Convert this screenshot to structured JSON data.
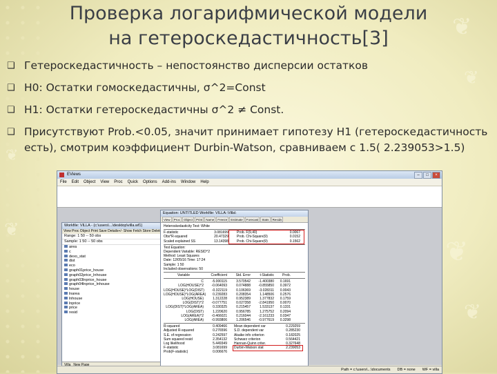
{
  "title_line1": "Проверка логарифмической модели",
  "title_line2": "на гетероскедастичность[3]",
  "bullets": [
    {
      "text": "Гетероскедастичность – непостоянство дисперсии остатков"
    },
    {
      "text": "H0: Остатки гомоскедастичны, σ^2=Const"
    },
    {
      "text": "H1: Остатки гетероскедастичны σ^2 ≠ Const."
    },
    {
      "text": "Присутствуют Prob.<0.05, значит принимает гипотезу H1 (гетероскедастичность есть), смотрим коэффициент Durbin-Watson, сравниваем с 1.5( 2.239053>1.5)"
    }
  ],
  "app": {
    "title": "EViews",
    "menu": [
      "File",
      "Edit",
      "Object",
      "View",
      "Proc",
      "Quick",
      "Options",
      "Add-ins",
      "Window",
      "Help"
    ],
    "status": {
      "path": "Path = c:\\users\\...\\documents",
      "db": "DB = none",
      "wf": "WF = villa"
    }
  },
  "workfile": {
    "title": "Workfile: VILLA - (c:\\users\\...\\desktop\\villa.wf1)",
    "toolbar": "View  Proc  Object  Print  Save  Details+/-  Show  Fetch  Store  Delete",
    "range": "Range:  1 50  --  50 obs",
    "sample": "Sample: 1 50  --  50 obs",
    "objects": [
      "area",
      "c",
      "dexo_stat",
      "dist",
      "eco",
      "graph01price_house",
      "graph02price_lnhouse",
      "graph03lnprice_house",
      "graph04lnprice_lnhouse",
      "house",
      "lnarea",
      "lnhouse",
      "lnprice",
      "price",
      "resid"
    ],
    "tabs": [
      "Villa",
      "New Page"
    ]
  },
  "equation": {
    "title": "Equation: UNTITLED   Workfile: VILLA::Villa\\",
    "buttons": [
      "View",
      "Proc",
      "Object",
      "Print",
      "Name",
      "Freeze",
      "Estimate",
      "Forecast",
      "Stats",
      "Resids"
    ],
    "test_title": "Heteroskedasticity Test: White",
    "stats": [
      {
        "label": "F-statistic",
        "value": "3.081699",
        "plabel": "Prob. F(9,40)",
        "p": "0.0067"
      },
      {
        "label": "Obs*R-squared",
        "value": "20.47329",
        "plabel": "Prob. Chi-Square(9)",
        "p": "0.0152"
      },
      {
        "label": "Scaled explained SS",
        "value": "13.14398",
        "plabel": "Prob. Chi-Square(9)",
        "p": "0.1562"
      }
    ],
    "info": [
      "Test Equation:",
      "Dependent Variable: RESID^2",
      "Method: Least Squares",
      "Date: 12/05/16   Time: 17:24",
      "Sample: 1 50",
      "Included observations: 50"
    ],
    "headers": [
      "Variable",
      "Coefficient",
      "Std. Error",
      "t-Statistic",
      "Prob."
    ],
    "rows": [
      [
        "C",
        "-5.000115",
        "3.570542",
        "-1.400380",
        "0.1691"
      ],
      [
        "LOG(HOUSE)^2",
        "-0.064093",
        "0.074888",
        "-0.855850",
        "0.3972"
      ],
      [
        "LOG(HOUSE)*LOG(DIST)",
        "-0.322119",
        "0.106369",
        "-3.028311",
        "0.0043"
      ],
      [
        "LOG(HOUSE)*LOG(AREA)",
        "0.239283",
        "0.208354",
        "1.148506",
        "0.2576"
      ],
      [
        "LOG(HOUSE)",
        "1.312228",
        "0.952389",
        "1.377832",
        "0.1759"
      ],
      [
        "LOG(DIST)^2",
        "-0.077751",
        "0.027358",
        "-2.841950",
        "0.0070"
      ],
      [
        "LOG(DIST)*LOG(AREA)",
        "0.330325",
        "0.215457",
        "1.533137",
        "0.1331"
      ],
      [
        "LOG(DIST)",
        "1.220620",
        "0.956785",
        "1.275752",
        "0.2094"
      ],
      [
        "LOG(AREA)^2",
        "-0.466021",
        "0.216044",
        "-2.161233",
        "0.0347"
      ],
      [
        "LOG(AREA)",
        "-0.993806",
        "1.206546",
        "-0.977619",
        "0.3298"
      ]
    ],
    "summary": [
      [
        "R-squared",
        "0.409466",
        "Mean dependent var",
        "0.229259"
      ],
      [
        "Adjusted R-squared",
        "0.276596",
        "S.D. dependent var",
        "0.285230"
      ],
      [
        "S.E. of regression",
        "0.242597",
        "Akaike info criterion",
        "0.182025"
      ],
      [
        "Sum squared resid",
        "2.354132",
        "Schwarz criterion",
        "0.564421"
      ],
      [
        "Log likelihood",
        "5.449349",
        "Hannan-Quinn criter.",
        "0.327648"
      ],
      [
        "F-statistic",
        "3.081699",
        "Durbin-Watson stat",
        "2.239053"
      ],
      [
        "Prob(F-statistic)",
        "0.006676",
        "",
        ""
      ]
    ]
  }
}
